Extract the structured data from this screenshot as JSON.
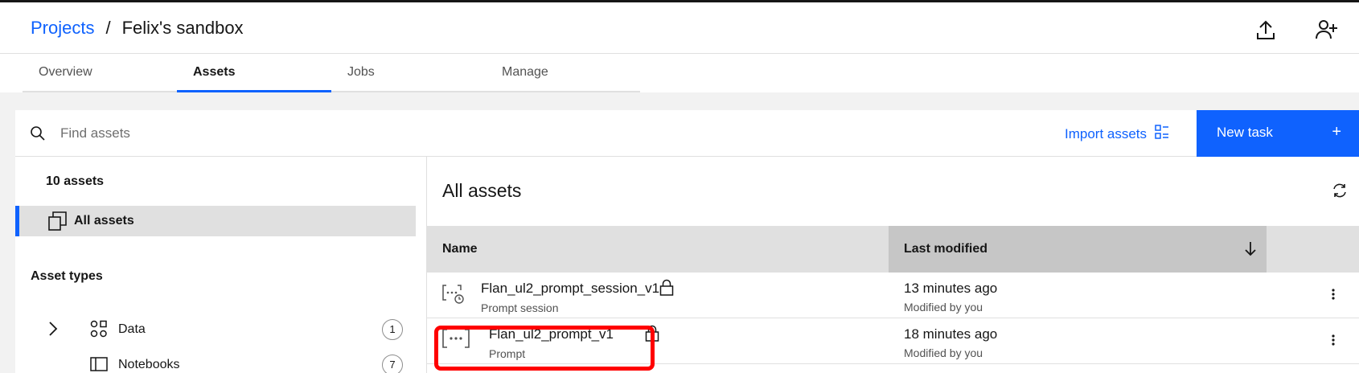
{
  "header": {
    "breadcrumb_root": "Projects",
    "breadcrumb_sep": "/",
    "project_name": "Felix's sandbox",
    "upload_icon": "upload-icon",
    "add_collaborator_icon": "add-user-icon"
  },
  "tabs": [
    {
      "label": "Overview",
      "active": false
    },
    {
      "label": "Assets",
      "active": true
    },
    {
      "label": "Jobs",
      "active": false
    },
    {
      "label": "Manage",
      "active": false
    }
  ],
  "toolbar": {
    "search_placeholder": "Find assets",
    "import_label": "Import assets",
    "new_task_label": "New task",
    "new_task_plus": "+"
  },
  "sidebar": {
    "count_label": "10 assets",
    "all_assets_label": "All assets",
    "asset_types_heading": "Asset types",
    "types": [
      {
        "label": "Data",
        "count": "1"
      },
      {
        "label": "Notebooks",
        "count": "7"
      }
    ]
  },
  "main": {
    "title": "All assets",
    "columns": {
      "name": "Name",
      "last_modified": "Last modified"
    },
    "rows": [
      {
        "name": "Flan_ul2_prompt_session_v1",
        "type": "Prompt session",
        "modified": "13 minutes ago",
        "by": "Modified by you",
        "icon": "prompt-session-icon"
      },
      {
        "name": "Flan_ul2_prompt_v1",
        "type": "Prompt",
        "modified": "18 minutes ago",
        "by": "Modified by you",
        "icon": "prompt-icon"
      }
    ]
  },
  "colors": {
    "accent": "#0f62fe",
    "highlight": "#ff0000"
  }
}
